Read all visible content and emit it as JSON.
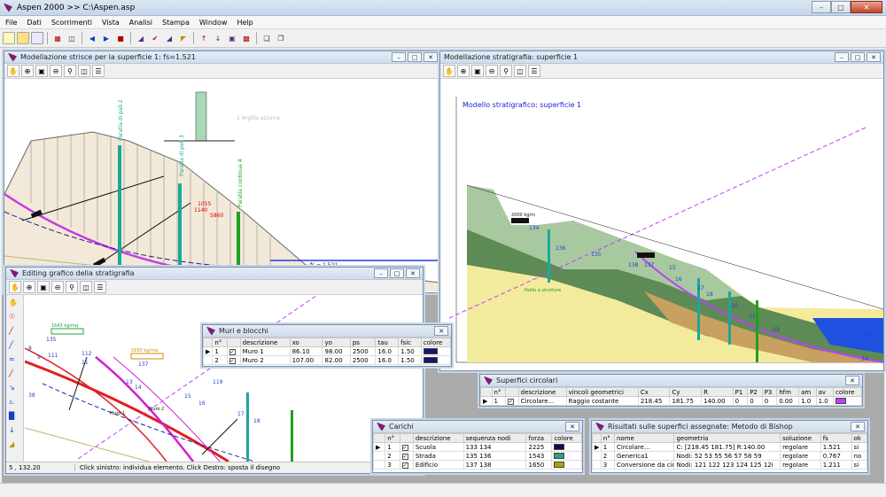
{
  "app": {
    "title": "Aspen 2000 >> C:\\Aspen.asp"
  },
  "menu": [
    "File",
    "Dati",
    "Scorrimenti",
    "Vista",
    "Analisi",
    "Stampa",
    "Window",
    "Help"
  ],
  "win1": {
    "title": "Modellazione strisce per la superficie 1: fs=1.521",
    "labels": {
      "paratia2": "Paratia di pali 2",
      "paratia3": "Paratia di pali 3",
      "paratia4": "Paratia continua 4",
      "fs": "fs = 1.521",
      "argilla": "1 Argilla azzurra",
      "d5860": "5860",
      "d1140": "1140",
      "d1055": "1055"
    }
  },
  "win2": {
    "title": "Modellazione stratigrafia: superficie 1",
    "heading": "Modello stratigrafico: superficie 1",
    "labels": {
      "n2000": "2000 kg/m",
      "n134": "134",
      "n136": "136",
      "n135": "135",
      "n138": "138",
      "n137": "137",
      "n33": "33",
      "n20": "20",
      "n22": "22",
      "n16": "16",
      "n17": "17",
      "n18": "18",
      "n21": "21",
      "n34": "34",
      "n15": "15",
      "falda": "Falda a strutture"
    }
  },
  "win3": {
    "title": "Editing grafico della stratigrafia",
    "status": "Click sinistro: individua elemento. Click Destro: sposta il disegno",
    "coords": "5 , 132.20",
    "labels": {
      "l1643": "1643 kg/mq",
      "l1650": "1650 kg/mq",
      "n135": "135",
      "n137": "137",
      "n8": "8",
      "n9": "9",
      "n111": "111",
      "n112": "112",
      "n11": "11",
      "n38": "38",
      "n13": "13",
      "n14": "14",
      "n18": "18",
      "n15": "15",
      "n16": "16",
      "n17": "17",
      "n119": "119",
      "muro1": "Muro 1",
      "muro2": "Muro 2"
    }
  },
  "muri": {
    "title": "Muri e blocchi",
    "headers": [
      "n°",
      "",
      "descrizione",
      "xo",
      "yo",
      "ps",
      "tau",
      "fsic",
      "colore"
    ],
    "rows": [
      [
        "1",
        "Muro 1",
        "86.10",
        "98.00",
        "2500",
        "16.0",
        "1.50"
      ],
      [
        "2",
        "Muro 2",
        "107.00",
        "82.00",
        "2500",
        "16.0",
        "1.50"
      ]
    ]
  },
  "superfici": {
    "title": "Superfici circolari",
    "headers": [
      "n°",
      "",
      "descrizione",
      "vincoli geometrici",
      "Cx",
      "Cy",
      "R",
      "P1",
      "P2",
      "P3",
      "hfm",
      "am",
      "av",
      "colore"
    ],
    "rows": [
      [
        "1",
        "Circolare...",
        "Raggio costante",
        "218.45",
        "181.75",
        "140.00",
        "0",
        "0",
        "0",
        "0.00",
        "1.0",
        "1.0"
      ]
    ]
  },
  "carichi": {
    "title": "Carichi",
    "headers": [
      "n°",
      "",
      "descrizione",
      "sequenza nodi",
      "forza",
      "colore"
    ],
    "rows": [
      [
        "1",
        "Scuola",
        "133 134",
        "2225"
      ],
      [
        "2",
        "Strada",
        "135 136",
        "1543"
      ],
      [
        "3",
        "Edificio",
        "137 138",
        "1650"
      ]
    ],
    "colors": [
      "#0a0a4a",
      "#2f9e7f",
      "#a9a400"
    ]
  },
  "risultati": {
    "title": "Risultati sulle superfici assegnate: Metodo di Bishop",
    "headers": [
      "n°",
      "nome",
      "geometria",
      "soluzione",
      "fs",
      "ok"
    ],
    "rows": [
      [
        "1",
        "Circolare...",
        "C: [218.45 181.75] R:140.00",
        "regolare",
        "1.521",
        "si"
      ],
      [
        "2",
        "Generica1",
        "Nodi: 52 53 55 56 57 58 59",
        "regolare",
        "0.767",
        "no"
      ],
      [
        "3",
        "Conversione da circolare",
        "Nodi: 121 122 123 124 125 12i",
        "regolare",
        "1.211",
        "si"
      ]
    ]
  },
  "colors": {
    "purple": "#c040ff",
    "magenta": "#ff2db0",
    "accent": "#5b2a86"
  }
}
